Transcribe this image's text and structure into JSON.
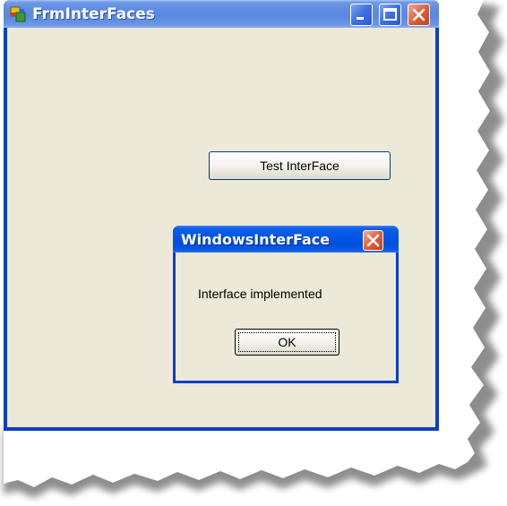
{
  "window": {
    "title": "FrmInterFaces",
    "controls": [
      "minimize-icon",
      "maximize-icon",
      "close-icon"
    ],
    "button_label": "Test InterFace"
  },
  "dialog": {
    "title": "WindowsInterFace",
    "message": "Interface implemented",
    "ok_label": "OK"
  },
  "colors": {
    "titlebar_inactive": "#6f9ae6",
    "titlebar_active": "#0055e5",
    "client_bg": "#ece9d8",
    "close_red": "#e0603c"
  }
}
